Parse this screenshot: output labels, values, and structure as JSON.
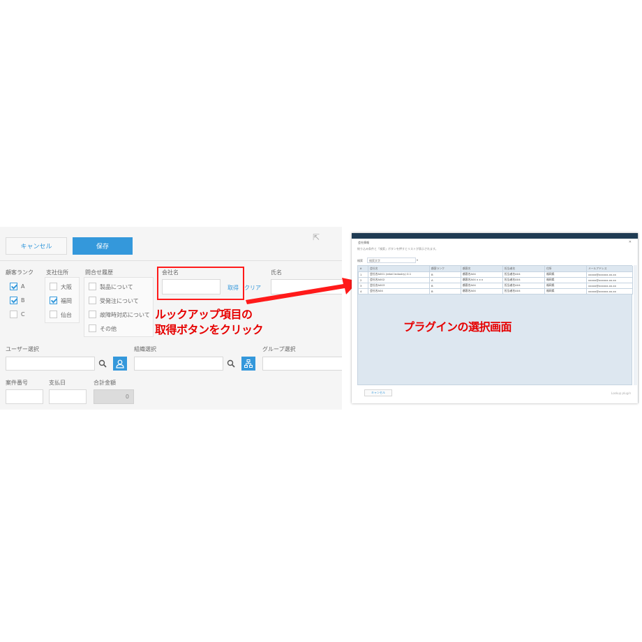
{
  "form": {
    "cancel_label": "キャンセル",
    "save_label": "保存",
    "customer_rank": {
      "label": "顧客ランク",
      "options": [
        {
          "text": "A",
          "checked": true
        },
        {
          "text": "B",
          "checked": true
        },
        {
          "text": "C",
          "checked": false
        }
      ]
    },
    "branch": {
      "label": "支社住所",
      "options": [
        {
          "text": "大阪",
          "checked": false
        },
        {
          "text": "福岡",
          "checked": true
        },
        {
          "text": "仙台",
          "checked": false
        }
      ]
    },
    "inquiry": {
      "label": "問合せ履歴",
      "options": [
        {
          "text": "製品について",
          "checked": false
        },
        {
          "text": "受発注について",
          "checked": false
        },
        {
          "text": "故障時対応について",
          "checked": false
        },
        {
          "text": "その他",
          "checked": false
        }
      ]
    },
    "company": {
      "label": "会社名",
      "fetch_label": "取得",
      "clear_label": "クリア"
    },
    "contact_name": {
      "label": "氏名"
    },
    "user_select": {
      "label": "ユーザー選択"
    },
    "org_select": {
      "label": "組織選択"
    },
    "group_select": {
      "label": "グループ選択"
    },
    "case_number": {
      "label": "案件番号"
    },
    "payment_date": {
      "label": "支払日"
    },
    "total_amount": {
      "label": "合計金額",
      "value": "0"
    }
  },
  "annotations": {
    "left_line1": "ルックアップ項目の",
    "left_line2": "取得ボタンをクリック",
    "right": "プラグインの選択画面"
  },
  "plugin": {
    "title": "会社情報",
    "description": "絞り込み条件と「検索」ボタンを押すとリストが表示されます。",
    "search_label": "検索",
    "search_placeholder": "検索文字",
    "columns": [
      "#",
      "会社名",
      "顧客ランク",
      "顧客名",
      "担当者名",
      "住所",
      "メールアドレス"
    ],
    "rows": [
      [
        "1",
        "会社名A001 (retail industry) 0.1",
        "B",
        "顧客名A04",
        "担当者名A04",
        "福岡県",
        "xxxxx@xxxxxx.xx.xx"
      ],
      [
        "2",
        "会社名A002",
        "A",
        "顧客名A04 x x x",
        "担当者名A04",
        "福岡県",
        "xxxxx@xxxxxx.xx.xx"
      ],
      [
        "3",
        "会社名A003",
        "B",
        "顧客名A04",
        "担当者名A04",
        "福岡県",
        "xxxxx@xxxxxx.xx.xx"
      ],
      [
        "4",
        "会社名A04",
        "B",
        "顧客名A04",
        "担当者名A04",
        "福岡県",
        "xxxxx@xxxxxx.xx.xx"
      ]
    ],
    "cancel_label": "キャンセル",
    "credit": "Lookup plugin"
  },
  "colors": {
    "accent": "#3498db",
    "annotation": "#e60000",
    "form_bg": "#f5f5f5",
    "grid_bg": "#dde7f0"
  }
}
